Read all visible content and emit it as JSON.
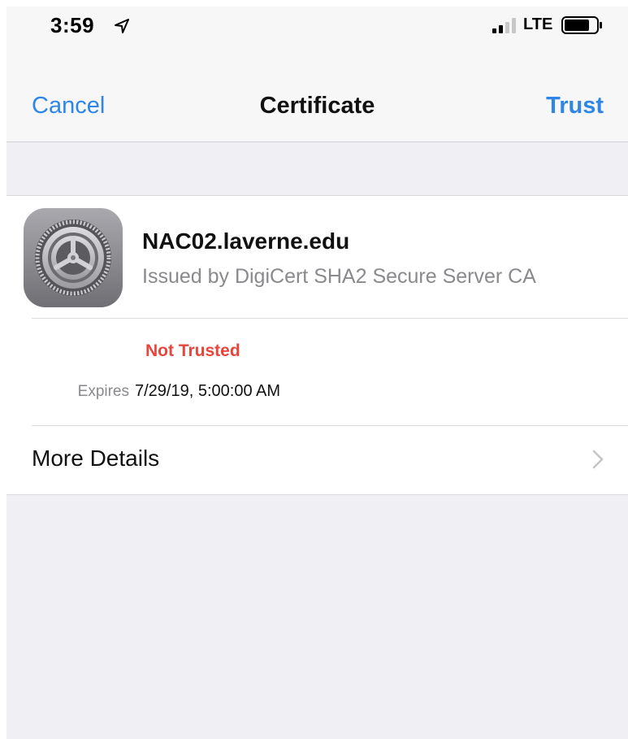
{
  "status_bar": {
    "time": "3:59",
    "network": "LTE",
    "icons": [
      "location-arrow-icon",
      "signal-icon",
      "battery-icon"
    ]
  },
  "nav": {
    "cancel_label": "Cancel",
    "title": "Certificate",
    "trust_label": "Trust"
  },
  "certificate": {
    "icon": "settings-gear-icon",
    "name": "NAC02.laverne.edu",
    "issuer": "Issued by DigiCert SHA2 Secure Server CA",
    "status": "Not Trusted",
    "expires_label": "Expires",
    "expires_value": "7/29/19, 5:00:00 AM"
  },
  "more_details": {
    "label": "More Details",
    "icon": "chevron-right-icon"
  },
  "colors": {
    "accent": "#2f86e7",
    "warning": "#e8453c",
    "background": "#efeff4",
    "secondary_text": "#8a8a8e"
  }
}
